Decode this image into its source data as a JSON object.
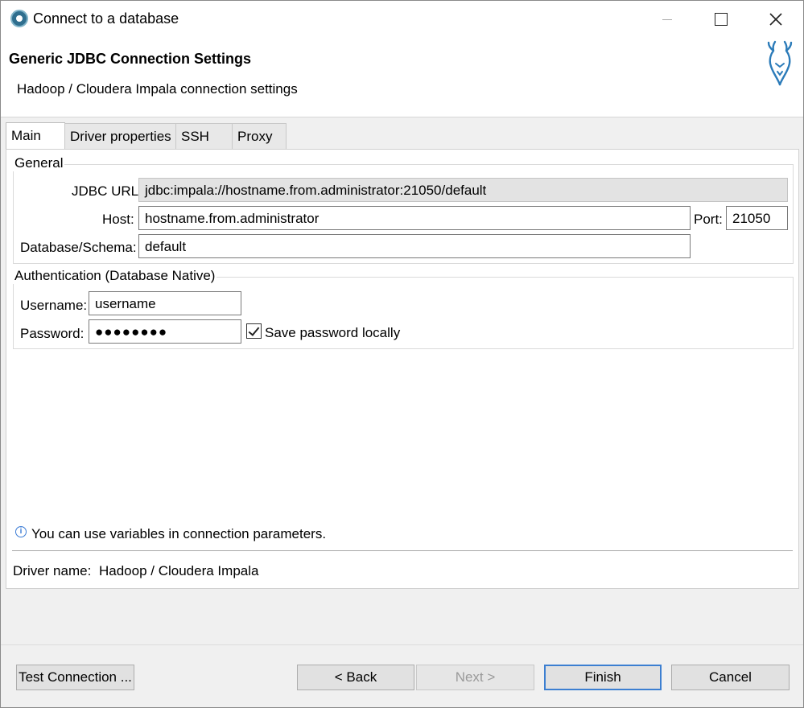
{
  "window": {
    "title": "Connect to a database"
  },
  "header": {
    "title": "Generic JDBC Connection Settings",
    "subtitle": "Hadoop / Cloudera Impala connection settings"
  },
  "tabs": [
    {
      "label": "Main"
    },
    {
      "label": "Driver properties"
    },
    {
      "label": "SSH"
    },
    {
      "label": "Proxy"
    }
  ],
  "general": {
    "legend": "General",
    "jdbc_url_label": "JDBC URL:",
    "jdbc_url_value": "jdbc:impala://hostname.from.administrator:21050/default",
    "host_label": "Host:",
    "host_value": "hostname.from.administrator",
    "port_label": "Port:",
    "port_value": "21050",
    "database_label": "Database/Schema:",
    "database_value": "default"
  },
  "auth": {
    "legend": "Authentication (Database Native)",
    "username_label": "Username:",
    "username_value": "username",
    "password_label": "Password:",
    "password_value": "●●●●●●●●",
    "save_password_label": "Save password locally",
    "save_password_checked": true
  },
  "info": {
    "text": "You can use variables in connection parameters."
  },
  "driver": {
    "label": "Driver name:",
    "value": "Hadoop / Cloudera Impala"
  },
  "buttons": {
    "test_connection": "Test Connection ...",
    "back": "< Back",
    "next": "Next >",
    "finish": "Finish",
    "cancel": "Cancel"
  },
  "colors": {
    "accent": "#3c7fd1",
    "logo": "#2b7bb9"
  }
}
